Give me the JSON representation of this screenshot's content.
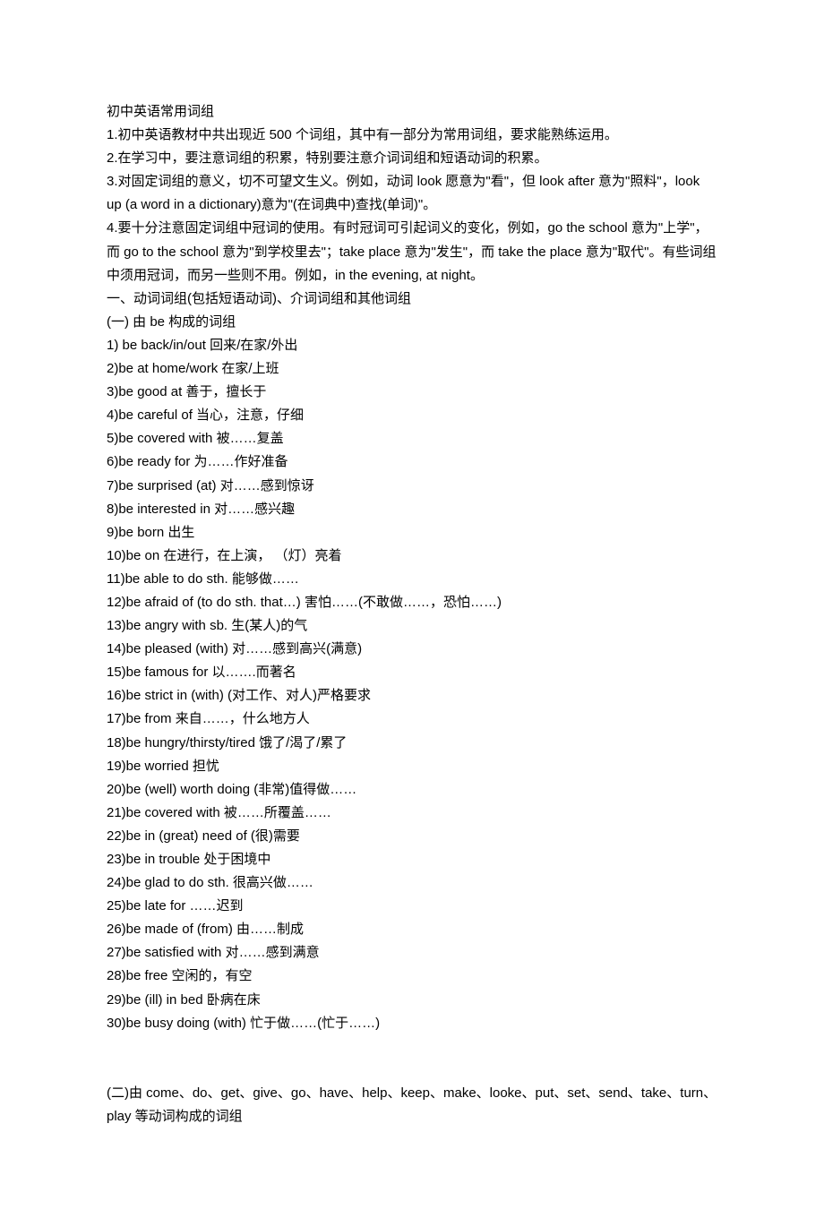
{
  "lines": [
    "初中英语常用词组",
    "1.初中英语教材中共出现近 500 个词组，其中有一部分为常用词组，要求能熟练运用。",
    "2.在学习中，要注意词组的积累，特别要注意介词词组和短语动词的积累。",
    "3.对固定词组的意义，切不可望文生义。例如，动词 look 愿意为\"看\"，但 look after 意为\"照料\"，look up (a word in a dictionary)意为\"(在词典中)查找(单词)\"。",
    "4.要十分注意固定词组中冠词的使用。有时冠词可引起词义的变化，例如，go the school 意为\"上学\"，而 go to the school 意为\"到学校里去\"；take place 意为\"发生\"，而 take the place 意为\"取代\"。有些词组中须用冠词，而另一些则不用。例如，in the evening, at night。",
    "一、动词词组(包括短语动词)、介词词组和其他词组",
    "(一)        由 be 构成的词组",
    "1)    be back/in/out 回来/在家/外出",
    " 2)be at home/work 在家/上班",
    "3)be good at 善于，擅长于",
    "4)be careful of 当心，注意，仔细",
    "5)be covered with 被……复盖",
    " 6)be ready for 为……作好准备",
    " 7)be surprised (at) 对……感到惊讶",
    " 8)be interested in 对……感兴趣",
    " 9)be born 出生",
    "10)be on 在进行，在上演，  （灯）亮着",
    "11)be able to do sth. 能够做……",
    "12)be afraid of (to do sth. that…) 害怕……(不敢做……，恐怕……)",
    "13)be angry with sb. 生(某人)的气",
    "14)be pleased (with) 对……感到高兴(满意)",
    "15)be famous for 以…….而著名",
    "16)be strict in (with) (对工作、对人)严格要求",
    "17)be from 来自……，什么地方人",
    "18)be hungry/thirsty/tired 饿了/渴了/累了",
    " 19)be worried 担忧",
    " 20)be (well) worth doing (非常)值得做……",
    "21)be covered with 被……所覆盖……",
    "22)be in (great) need of (很)需要",
    " 23)be in trouble 处于困境中",
    "24)be glad to do sth. 很高兴做……",
    " 25)be late for ……迟到",
    "26)be made of (from) 由……制成",
    " 27)be satisfied with 对……感到满意",
    " 28)be free 空闲的，有空",
    "29)be (ill) in bed 卧病在床",
    "30)be busy doing (with) 忙于做……(忙于……)",
    "",
    "",
    "(二)由 come、do、get、give、go、have、help、keep、make、looke、put、set、send、take、turn、play 等动词构成的词组"
  ]
}
